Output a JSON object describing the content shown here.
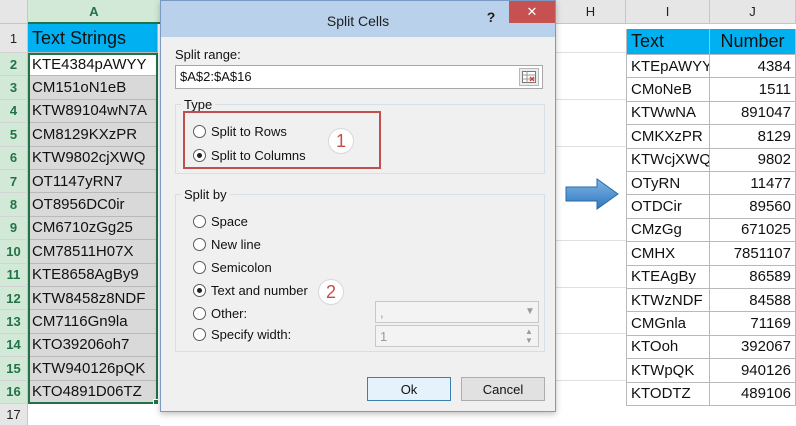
{
  "left_sheet": {
    "column_header": "A",
    "row_numbers": [
      "1",
      "2",
      "3",
      "4",
      "5",
      "6",
      "7",
      "8",
      "9",
      "10",
      "11",
      "12",
      "13",
      "14",
      "15",
      "16",
      "17"
    ],
    "header": "Text Strings",
    "cells": [
      "KTE4384pAWYY",
      "CM151oN1eB",
      "KTW89104wN7A",
      "CM8129KXzPR",
      "KTW9802cjXWQ",
      "OT1147yRN7",
      "OT8956DC0ir",
      "CM6710zGg25",
      "CM78511H07X",
      "KTE8658AgBy9",
      "KTW8458z8NDF",
      "CM7116Gn9la",
      "KTO39206oh7",
      "KTW940126pQK",
      "KTO4891D06TZ"
    ]
  },
  "middle_sheet": {
    "column_header": "H"
  },
  "right_sheet": {
    "column_headers": [
      "I",
      "J"
    ],
    "header_text": "Text",
    "header_number": "Number",
    "rows": [
      {
        "text": "KTEpAWYY",
        "number": "4384"
      },
      {
        "text": "CMoNeB",
        "number": "1511"
      },
      {
        "text": "KTWwNA",
        "number": "891047"
      },
      {
        "text": "CMKXzPR",
        "number": "8129"
      },
      {
        "text": "KTWcjXWQ",
        "number": "9802"
      },
      {
        "text": "OTyRN",
        "number": "11477"
      },
      {
        "text": "OTDCir",
        "number": "89560"
      },
      {
        "text": "CMzGg",
        "number": "671025"
      },
      {
        "text": "CMHX",
        "number": "7851107"
      },
      {
        "text": "KTEAgBy",
        "number": "86589"
      },
      {
        "text": "KTWzNDF",
        "number": "84588"
      },
      {
        "text": "CMGnla",
        "number": "71169"
      },
      {
        "text": "KTOoh",
        "number": "392067"
      },
      {
        "text": "KTWpQK",
        "number": "940126"
      },
      {
        "text": "KTODTZ",
        "number": "489106"
      }
    ]
  },
  "dialog": {
    "title": "Split Cells",
    "help": "?",
    "close": "✕",
    "split_range_label": "Split range:",
    "split_range_value": "$A$2:$A$16",
    "type_label": "Type",
    "split_to_rows": "Split to Rows",
    "split_to_columns": "Split to Columns",
    "split_by_label": "Split by",
    "space": "Space",
    "new_line": "New line",
    "semicolon": "Semicolon",
    "text_and_number": "Text and number",
    "other": "Other:",
    "other_value": ",",
    "specify_width": "Specify width:",
    "width_value": "1",
    "ok": "Ok",
    "cancel": "Cancel",
    "marker_1": "1",
    "marker_2": "2"
  },
  "colors": {
    "header_fill": "#00b0f0",
    "selection_green": "#217346",
    "highlight_red": "#c0504d",
    "arrow_blue": "#3a86c8"
  }
}
